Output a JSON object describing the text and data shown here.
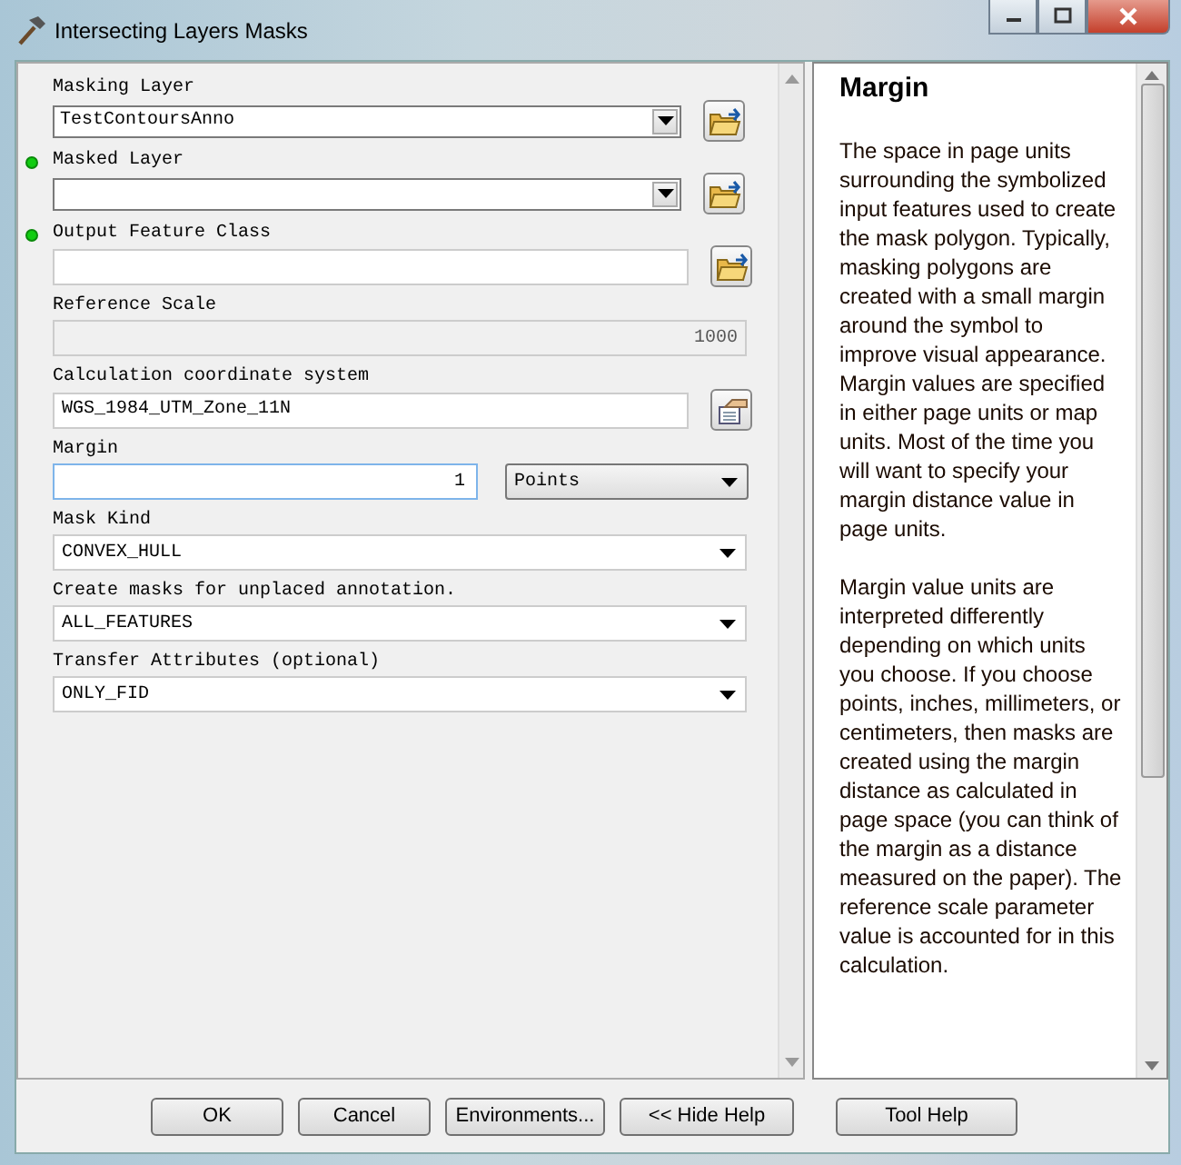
{
  "window": {
    "title": "Intersecting Layers Masks"
  },
  "params": [
    {
      "label": "Masking Layer",
      "required": false,
      "kind": "combo",
      "value": "TestContoursAnno",
      "browse": true
    },
    {
      "label": "Masked Layer",
      "required": true,
      "kind": "combo",
      "browse": true
    },
    {
      "label": "Output Feature Class",
      "required": true,
      "kind": "text",
      "browse": true
    },
    {
      "label": "Reference Scale",
      "required": false,
      "kind": "readonly",
      "value": "1000"
    },
    {
      "label": "Calculation coordinate system",
      "required": false,
      "kind": "coordinates",
      "value": "WGS_1984_UTM_Zone_11N",
      "browse": true
    },
    {
      "label": "Margin",
      "required": false,
      "kind": "number-units",
      "value": "1",
      "units": "Points"
    },
    {
      "label": "Mask Kind",
      "required": false,
      "kind": "select",
      "value": "CONVEX_HULL"
    },
    {
      "label": "Create masks for unplaced annotation.",
      "required": false,
      "kind": "select",
      "value": "ALL_FEATURES"
    },
    {
      "label": "Transfer Attributes (optional)",
      "required": false,
      "kind": "select",
      "value": "ONLY_FID"
    }
  ],
  "help": {
    "title": "Margin",
    "paragraphs": [
      "The space in page units surrounding the symbolized input features used to create the mask polygon. Typically, masking polygons are created with a small margin around the symbol to improve visual appearance. Margin values are specified in either page units or map units. Most of the time you will want to specify your margin distance value in page units.",
      "Margin value units are interpreted differently depending on which units you choose. If you choose points, inches, millimeters, or centimeters, then masks are created using the margin distance as calculated in page space (you can think of the margin as a distance measured on the paper). The reference scale parameter value is accounted for in this calculation."
    ]
  },
  "buttons": [
    "OK",
    "Cancel",
    "Environments...",
    "<< Hide Help",
    "Tool Help"
  ]
}
